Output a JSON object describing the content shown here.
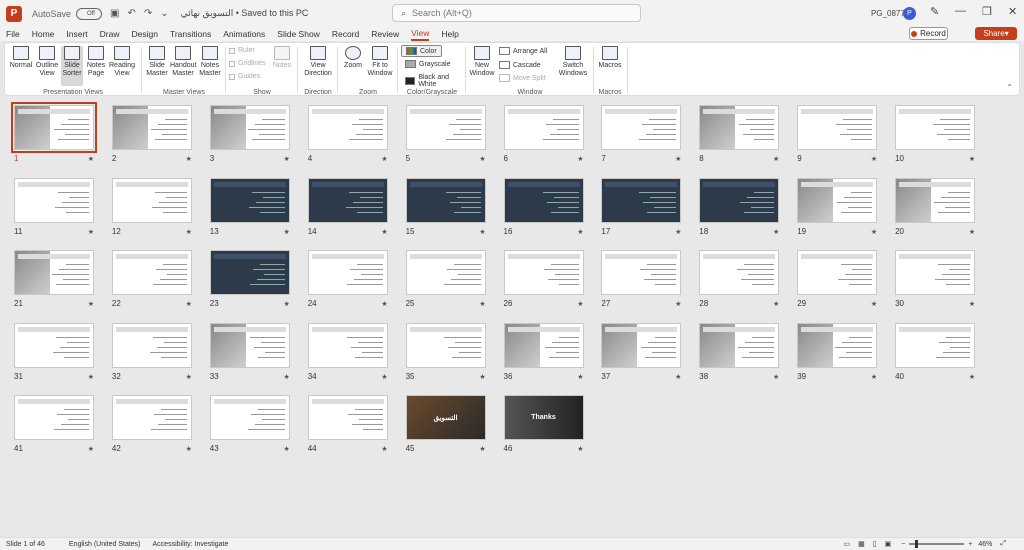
{
  "titlebar": {
    "autosave_label": "AutoSave",
    "autosave_state": "Off",
    "doc_title": "التسويق نهائي • Saved to this PC",
    "search_placeholder": "Search (Alt+Q)",
    "user_name": "PG_08772",
    "avatar_initial": "P"
  },
  "tabs": [
    "File",
    "Home",
    "Insert",
    "Draw",
    "Design",
    "Transitions",
    "Animations",
    "Slide Show",
    "Record",
    "Review",
    "View",
    "Help"
  ],
  "active_tab": "View",
  "record_label": "Record",
  "share_label": "Share",
  "ribbon": {
    "presentation_views": {
      "label": "Presentation Views",
      "buttons": [
        "Normal",
        "Outline View",
        "Slide Sorter",
        "Notes Page",
        "Reading View"
      ]
    },
    "master_views": {
      "label": "Master Views",
      "buttons": [
        "Slide Master",
        "Handout Master",
        "Notes Master"
      ]
    },
    "show": {
      "label": "Show",
      "items": [
        "Ruler",
        "Gridlines",
        "Guides"
      ],
      "notes": "Notes"
    },
    "direction": {
      "label": "Direction",
      "button": "View Direction"
    },
    "zoom": {
      "label": "Zoom",
      "buttons": [
        "Zoom",
        "Fit to Window"
      ]
    },
    "color": {
      "label": "Color/Grayscale",
      "items": [
        "Color",
        "Grayscale",
        "Black and White"
      ]
    },
    "window": {
      "label": "Window",
      "new_window": "New Window",
      "items": [
        "Arrange All",
        "Cascade",
        "Move Split"
      ],
      "switch": "Switch Windows"
    },
    "macros": {
      "label": "Macros",
      "button": "Macros"
    }
  },
  "slides": {
    "count": 46,
    "selected": 1,
    "star_glyph": "★",
    "slide_45_text": "التسويق",
    "slide_46_text": "Thanks"
  },
  "status": {
    "slide_info": "Slide 1 of 46",
    "language": "English (United States)",
    "accessibility": "Accessibility: Investigate",
    "zoom": "46%"
  }
}
